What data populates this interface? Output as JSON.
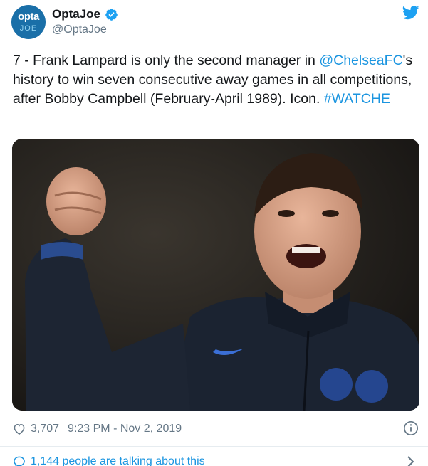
{
  "account": {
    "avatar_line1": "opta",
    "avatar_line2": "JOE",
    "display_name": "OptaJoe",
    "handle": "@OptaJoe"
  },
  "tweet": {
    "text_part1": "7 - Frank Lampard is only the second manager in ",
    "mention": "@ChelseaFC",
    "text_part2": "'s history to win seven consecutive away games in all competitions, after Bobby Campbell (February-April 1989). Icon. ",
    "hashtag": "#WATCHE"
  },
  "meta": {
    "likes": "3,707",
    "timestamp": "9:23 PM - Nov 2, 2019"
  },
  "footer": {
    "talking": "1,144 people are talking about this"
  },
  "colors": {
    "link": "#1b95e0",
    "muted": "#657786",
    "verified": "#1da1f2"
  },
  "icons": [
    "verified-badge-icon",
    "twitter-bird-icon",
    "heart-icon",
    "info-icon",
    "reply-icon",
    "chevron-right-icon"
  ]
}
